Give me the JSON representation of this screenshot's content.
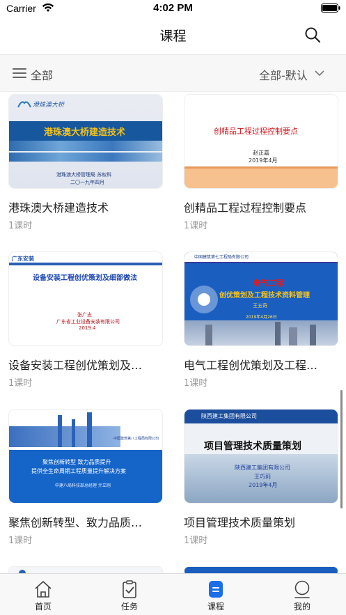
{
  "status_bar": {
    "carrier": "Carrier",
    "time": "4:02 PM"
  },
  "nav": {
    "title": "课程",
    "search_icon": "search-icon"
  },
  "filter": {
    "left_label": "全部",
    "right_label": "全部-默认"
  },
  "courses": [
    {
      "title": "港珠澳大桥建造技术",
      "meta": "1课时",
      "thumb": {
        "logo": "港珠澳大桥",
        "heading": "港珠澳大桥建造技术",
        "line1": "港珠澳大桥管理局 苏权科",
        "line2": "二〇一九年四月"
      }
    },
    {
      "title": "创精品工程过程控制要点",
      "meta": "1课时",
      "thumb": {
        "heading": "创精品工程过程控制要点",
        "line1": "赵正嘉",
        "line2": "2019年4月"
      }
    },
    {
      "title": "设备安装工程创优策划及…",
      "meta": "1课时",
      "thumb": {
        "logo": "广东安装",
        "heading": "设备安装工程创优策划及细部做法",
        "line1": "张广志",
        "line2": "广东省工业设备安装有限公司",
        "line3": "2019.4"
      }
    },
    {
      "title": "电气工程创优策划及工程…",
      "meta": "1课时",
      "thumb": {
        "header": "中国建筑第七工程局有限公司",
        "heading1": "电气工程",
        "heading2": "创优策划及工程技术资料管理",
        "line1": "王五奇",
        "line2": "2019年4月26日"
      }
    },
    {
      "title": "聚焦创新转型、致力品质…",
      "meta": "1课时",
      "thumb": {
        "header": "中国建筑第八工程局有限公司",
        "line1": "聚焦创新转型  致力品质提升",
        "line2": "提供全生命周期工程质量提升解决方案",
        "line3": "中建八局科技部总经理  亓立刚"
      }
    },
    {
      "title": "项目管理技术质量策划",
      "meta": "1课时",
      "thumb": {
        "header": "陕西建工集团有限公司",
        "heading": "项目管理技术质量策划",
        "line1": "陕西建工集团有限公司",
        "line2": "王巧莉",
        "line3": "2019年4月"
      }
    }
  ],
  "tabs": [
    {
      "label": "首页",
      "icon": "home-icon",
      "active": false
    },
    {
      "label": "任务",
      "icon": "clipboard-check-icon",
      "active": false
    },
    {
      "label": "课程",
      "icon": "course-icon",
      "active": true
    },
    {
      "label": "我的",
      "icon": "profile-icon",
      "active": false
    }
  ],
  "colors": {
    "accent": "#1a6ee8",
    "meta_text": "#999999",
    "filter_bg": "#f7f7f7"
  }
}
